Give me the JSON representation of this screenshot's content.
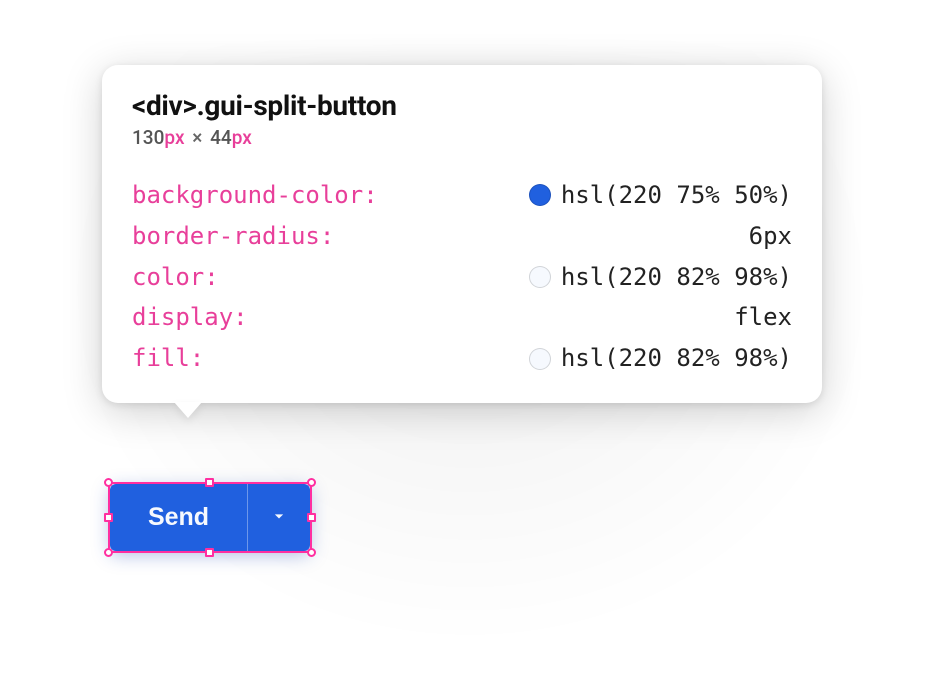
{
  "tooltip": {
    "selector": "<div>.gui-split-button",
    "dims": {
      "w": "130",
      "h": "44",
      "unit": "px"
    },
    "props": [
      {
        "name": "background-color",
        "value": "hsl(220 75% 50%)",
        "swatch": "hsl(220 75% 50%)"
      },
      {
        "name": "border-radius",
        "value": "6px"
      },
      {
        "name": "color",
        "value": "hsl(220 82% 98%)",
        "swatch": "hsl(220 82% 98%)"
      },
      {
        "name": "display",
        "value": "flex"
      },
      {
        "name": "fill",
        "value": "hsl(220 82% 98%)",
        "swatch": "hsl(220 82% 98%)"
      }
    ]
  },
  "button": {
    "label": "Send"
  },
  "colors": {
    "accent": "#ff2fa0",
    "primary": "hsl(220 75% 50%)",
    "onPrimary": "hsl(220 82% 98%)"
  }
}
